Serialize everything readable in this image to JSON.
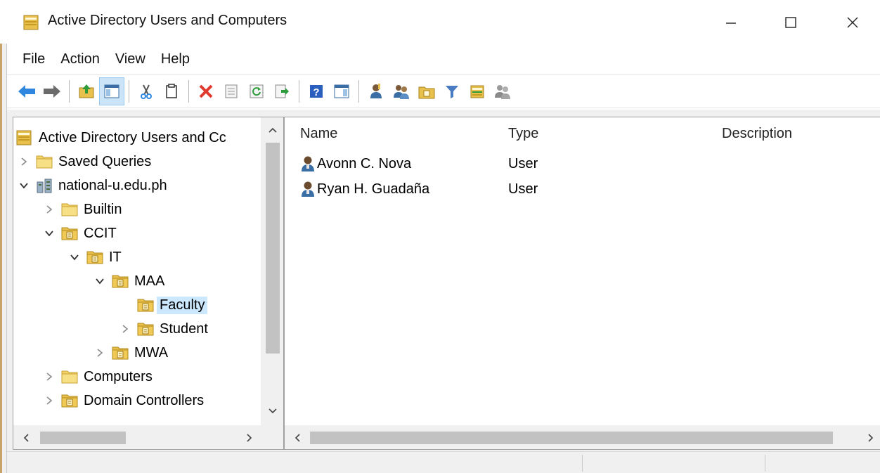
{
  "window": {
    "title": "Active Directory Users and Computers",
    "controls": {
      "minimize": "—",
      "maximize": "☐",
      "close": "✕"
    }
  },
  "menu": [
    "File",
    "Action",
    "View",
    "Help"
  ],
  "toolbar": {
    "icons": [
      "back-icon",
      "forward-icon",
      "up-level-icon",
      "show-hide-console-tree-icon",
      "cut-icon",
      "copy-icon",
      "delete-icon",
      "properties-icon",
      "refresh-icon",
      "export-list-icon",
      "help-icon",
      "show-hide-action-pane-icon",
      "new-user-icon",
      "new-group-icon",
      "new-ou-icon",
      "filter-icon",
      "find-icon",
      "add-to-group-icon"
    ]
  },
  "tree": {
    "root": "Active Directory Users and Cc",
    "items": [
      {
        "label": "Saved Queries",
        "level": 1,
        "expander": ">",
        "icon": "folder-icon"
      },
      {
        "label": "national-u.edu.ph",
        "level": 1,
        "expander": "v",
        "icon": "domain-icon"
      },
      {
        "label": "Builtin",
        "level": 2,
        "expander": ">",
        "icon": "folder-icon"
      },
      {
        "label": "CCIT",
        "level": 2,
        "expander": "v",
        "icon": "ou-icon"
      },
      {
        "label": "IT",
        "level": 3,
        "expander": "v",
        "icon": "ou-icon"
      },
      {
        "label": "MAA",
        "level": 4,
        "expander": "v",
        "icon": "ou-icon"
      },
      {
        "label": "Faculty",
        "level": 5,
        "expander": "",
        "icon": "ou-icon",
        "selected": true
      },
      {
        "label": "Student",
        "level": 5,
        "expander": ">",
        "icon": "ou-icon"
      },
      {
        "label": "MWA",
        "level": 4,
        "expander": ">",
        "icon": "ou-icon"
      },
      {
        "label": "Computers",
        "level": 2,
        "expander": ">",
        "icon": "folder-icon"
      },
      {
        "label": "Domain Controllers",
        "level": 2,
        "expander": ">",
        "icon": "ou-icon"
      }
    ]
  },
  "list": {
    "columns": [
      "Name",
      "Type",
      "Description"
    ],
    "rows": [
      {
        "name": "Avonn C. Nova",
        "type": "User",
        "description": ""
      },
      {
        "name": "Ryan H. Guadaña",
        "type": "User",
        "description": ""
      }
    ]
  },
  "colors": {
    "selection": "#cce8ff",
    "toolbar_active": "#cce4f7",
    "folder": "#f3d46b"
  }
}
